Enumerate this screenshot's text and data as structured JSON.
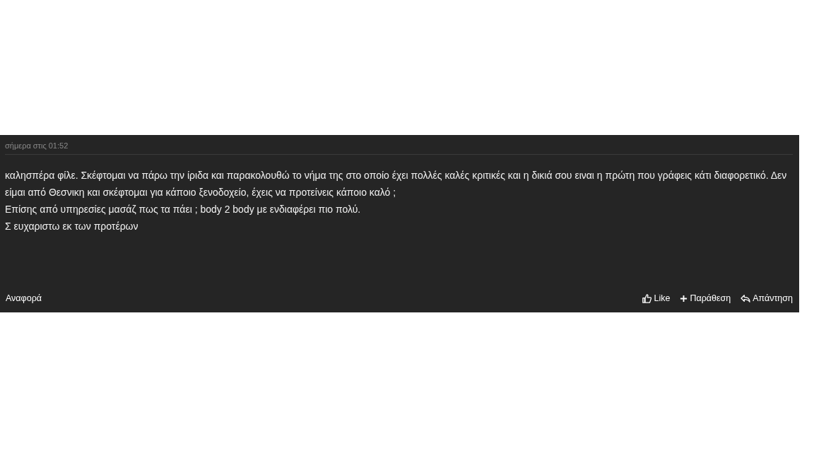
{
  "post": {
    "timestamp": "σήμερα στις 01:52",
    "paragraphs": [
      "καλησπέρα φίλε. Σκέφτομαι να πάρω την ίριδα και παρακολουθώ το νήμα της στο οποίο έχει πολλές καλές κριτικές και η δικιά σου ειναι η πρώτη που γράφεις κάτι διαφορετικό. Δεν είμαι από Θεσνικη και σκέφτομαι για κάποιο ξενοδοχείο, έχεις να προτείνεις κάποιο καλό ;",
      "Επίσης από υπηρεσίες μασάζ πως τα πάει ; body 2 body με ενδιαφέρει πιο πολύ.",
      "Σ ευχαριστω εκ των προτέρων"
    ],
    "report": "Αναφορά",
    "actions": [
      {
        "kind": "like",
        "label": "Like"
      },
      {
        "kind": "quote",
        "label": "Παράθεση"
      },
      {
        "kind": "reply",
        "label": "Απάντηση"
      }
    ]
  }
}
